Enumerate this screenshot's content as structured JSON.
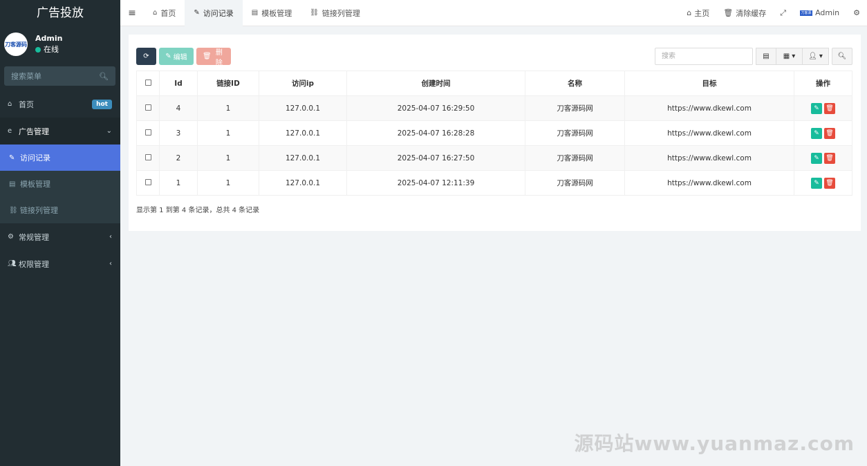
{
  "brand": "广告投放",
  "user": {
    "avatar_text": "刀客源码",
    "name": "Admin",
    "status": "在线"
  },
  "sidebar": {
    "search_placeholder": "搜索菜单",
    "items": [
      {
        "label": "首页",
        "icon": "home-icon",
        "badge": "hot"
      },
      {
        "label": "广告管理",
        "icon": "ie-icon"
      },
      {
        "label": "常规管理",
        "icon": "cogs-icon"
      },
      {
        "label": "权限管理",
        "icon": "group-icon"
      }
    ],
    "submenu": [
      {
        "label": "访问记录",
        "icon": "pencil-icon"
      },
      {
        "label": "模板管理",
        "icon": "list-icon"
      },
      {
        "label": "链接列管理",
        "icon": "link-icon"
      }
    ]
  },
  "topnav": {
    "tabs": [
      {
        "label": "首页",
        "icon": "home-icon"
      },
      {
        "label": "访问记录",
        "icon": "pencil-icon"
      },
      {
        "label": "模板管理",
        "icon": "list-icon"
      },
      {
        "label": "链接列管理",
        "icon": "link-icon"
      }
    ],
    "right": {
      "home": "主页",
      "clear_cache": "清除缓存",
      "admin": "Admin",
      "mini_logo": "刀客源码"
    }
  },
  "toolbar": {
    "edit": "编辑",
    "delete": "删除",
    "search_placeholder": "搜索"
  },
  "table": {
    "headers": [
      "Id",
      "链接ID",
      "访问ip",
      "创建时间",
      "名称",
      "目标",
      "操作"
    ],
    "rows": [
      {
        "id": "4",
        "link_id": "1",
        "ip": "127.0.0.1",
        "time": "2025-04-07 16:29:50",
        "name": "刀客源码网",
        "target": "https://www.dkewl.com"
      },
      {
        "id": "3",
        "link_id": "1",
        "ip": "127.0.0.1",
        "time": "2025-04-07 16:28:28",
        "name": "刀客源码网",
        "target": "https://www.dkewl.com"
      },
      {
        "id": "2",
        "link_id": "1",
        "ip": "127.0.0.1",
        "time": "2025-04-07 16:27:50",
        "name": "刀客源码网",
        "target": "https://www.dkewl.com"
      },
      {
        "id": "1",
        "link_id": "1",
        "ip": "127.0.0.1",
        "time": "2025-04-07 12:11:39",
        "name": "刀客源码网",
        "target": "https://www.dkewl.com"
      }
    ]
  },
  "pager_info": "显示第 1 到第 4 条记录，总共 4 条记录",
  "watermark": "源码站www.yuanmaz.com",
  "colors": {
    "sidebar_bg": "#222d32",
    "active": "#4e73df",
    "edit": "#18bc9c",
    "delete": "#e74c3c"
  }
}
